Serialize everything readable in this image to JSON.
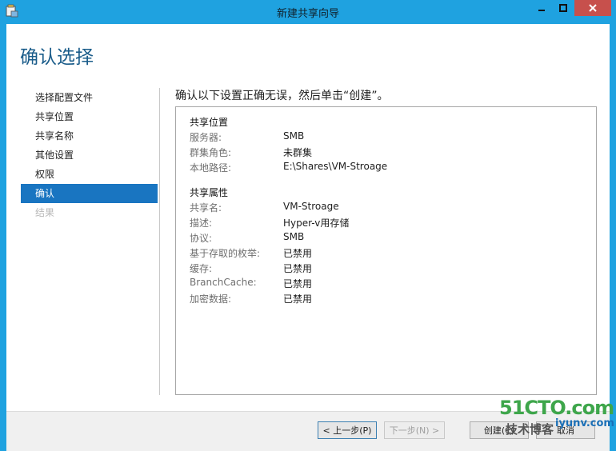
{
  "window": {
    "title": "新建共享向导"
  },
  "header": {
    "title": "确认选择"
  },
  "nav": {
    "items": [
      {
        "label": "选择配置文件",
        "state": "normal"
      },
      {
        "label": "共享位置",
        "state": "normal"
      },
      {
        "label": "共享名称",
        "state": "normal"
      },
      {
        "label": "其他设置",
        "state": "normal"
      },
      {
        "label": "权限",
        "state": "normal"
      },
      {
        "label": "确认",
        "state": "active"
      },
      {
        "label": "结果",
        "state": "disabled"
      }
    ]
  },
  "main": {
    "heading": "确认以下设置正确无误，然后单击“创建”。",
    "sections": [
      {
        "title": "共享位置",
        "rows": [
          {
            "key": "服务器:",
            "value": "SMB"
          },
          {
            "key": "群集角色:",
            "value": "未群集"
          },
          {
            "key": "本地路径:",
            "value": "E:\\Shares\\VM-Stroage"
          }
        ]
      },
      {
        "title": "共享属性",
        "rows": [
          {
            "key": "共享名:",
            "value": "VM-Stroage"
          },
          {
            "key": "描述:",
            "value": "Hyper-v用存储"
          },
          {
            "key": "协议:",
            "value": "SMB"
          },
          {
            "key": "基于存取的枚举:",
            "value": "已禁用"
          },
          {
            "key": "缓存:",
            "value": "已禁用"
          },
          {
            "key": "BranchCache:",
            "value": "已禁用"
          },
          {
            "key": "加密数据:",
            "value": "已禁用"
          }
        ]
      }
    ]
  },
  "footer": {
    "prev_label": "< 上一步(P)",
    "next_label": "下一步(N) >",
    "create_label": "创建(C)",
    "cancel_label": "取消"
  },
  "watermark": {
    "top": "51CTO.com",
    "bottom": "技术博客",
    "right": "iyunv.com"
  },
  "colors": {
    "titlebar": "#1fa2e0",
    "accent": "#1975c1",
    "title_text": "#1a5c8a",
    "close": "#c7504c"
  }
}
